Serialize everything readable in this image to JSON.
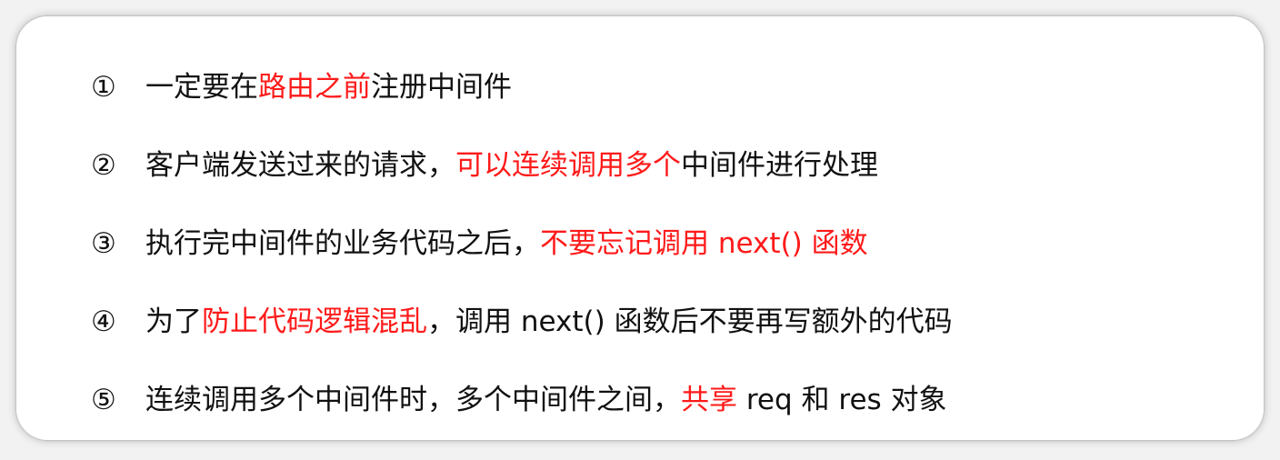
{
  "colors": {
    "text": "#111111",
    "highlight": "#ff1a1a",
    "card_background": "#ffffff"
  },
  "items": [
    {
      "num": "①",
      "segments": [
        {
          "text": "一定要在",
          "highlight": false
        },
        {
          "text": "路由之前",
          "highlight": true
        },
        {
          "text": "注册中间件",
          "highlight": false
        }
      ]
    },
    {
      "num": "②",
      "segments": [
        {
          "text": "客户端发送过来的请求，",
          "highlight": false
        },
        {
          "text": "可以连续调用多个",
          "highlight": true
        },
        {
          "text": "中间件进行处理",
          "highlight": false
        }
      ]
    },
    {
      "num": "③",
      "segments": [
        {
          "text": "执行完中间件的业务代码之后，",
          "highlight": false
        },
        {
          "text": "不要忘记调用 next() 函数",
          "highlight": true
        }
      ]
    },
    {
      "num": "④",
      "segments": [
        {
          "text": "为了",
          "highlight": false
        },
        {
          "text": "防止代码逻辑混乱",
          "highlight": true
        },
        {
          "text": "，调用 next() 函数后不要再写额外的代码",
          "highlight": false
        }
      ]
    },
    {
      "num": "⑤",
      "segments": [
        {
          "text": "连续调用多个中间件时，多个中间件之间，",
          "highlight": false
        },
        {
          "text": "共享",
          "highlight": true
        },
        {
          "text": " req 和 res 对象",
          "highlight": false
        }
      ]
    }
  ]
}
